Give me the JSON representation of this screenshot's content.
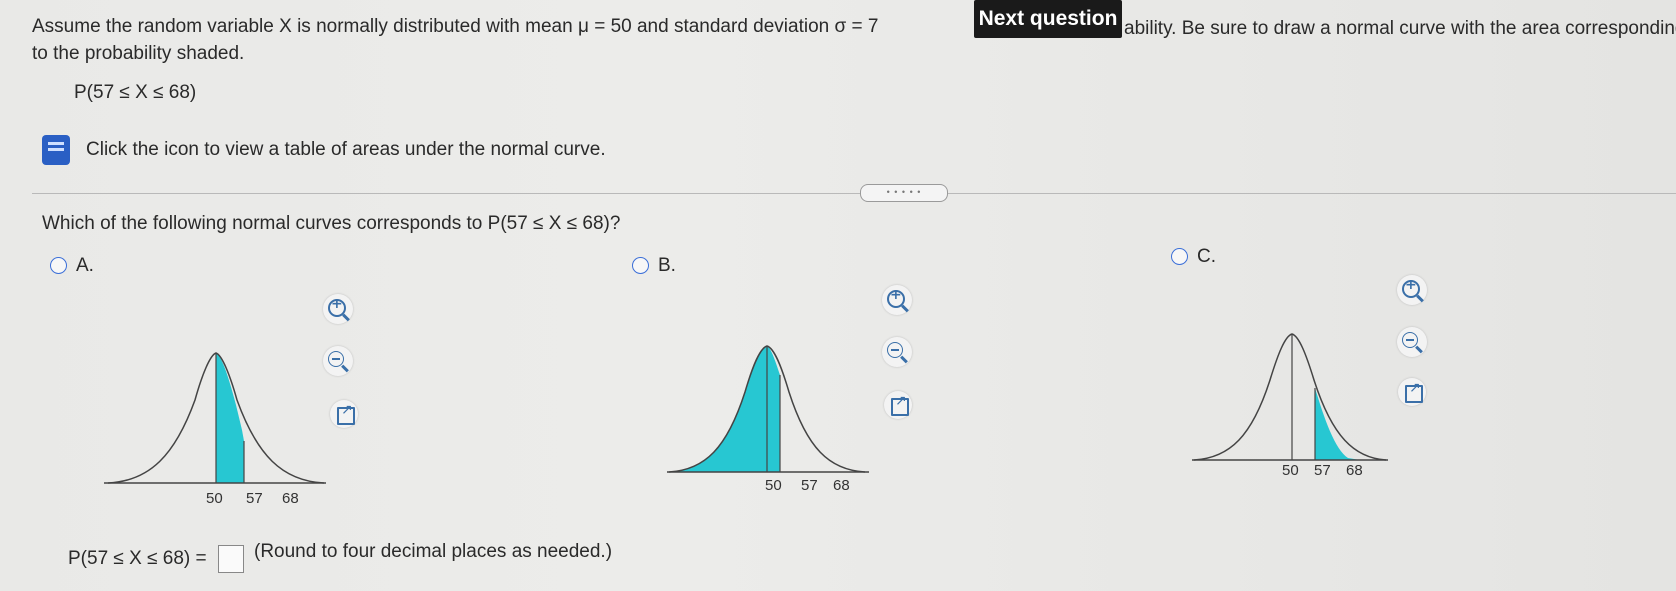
{
  "question": {
    "line1_left": "Assume the random variable X is normally distributed with mean μ = 50 and standard deviation σ = 7",
    "line1_right": "ability. Be sure to draw a normal curve with the area corresponding",
    "line2": "to the probability shaded.",
    "expression": "P(57 ≤ X ≤ 68)"
  },
  "tooltip": {
    "label": "Next question"
  },
  "help": {
    "text": "Click the icon to view a table of areas under the normal curve."
  },
  "divider_handle": "• • • • •",
  "prompt": "Which of the following normal curves corresponds to P(57 ≤ X ≤ 68)?",
  "options": [
    {
      "label": "A.",
      "ticks": [
        "50",
        "57",
        "68"
      ]
    },
    {
      "label": "B.",
      "ticks": [
        "50",
        "57",
        "68"
      ]
    },
    {
      "label": "C.",
      "ticks": [
        "50",
        "57",
        "68"
      ]
    }
  ],
  "answer": {
    "prefix": "P(57 ≤ X ≤ 68) =",
    "note": "(Round to four decimal places as needed.)"
  },
  "colors": {
    "shade": "#27c7d2",
    "radio": "#3b6fd8",
    "tooltip_bg": "#1a1a1a"
  },
  "icons": [
    "book-icon",
    "zoom-in-icon",
    "zoom-out-icon",
    "external-link-icon"
  ]
}
